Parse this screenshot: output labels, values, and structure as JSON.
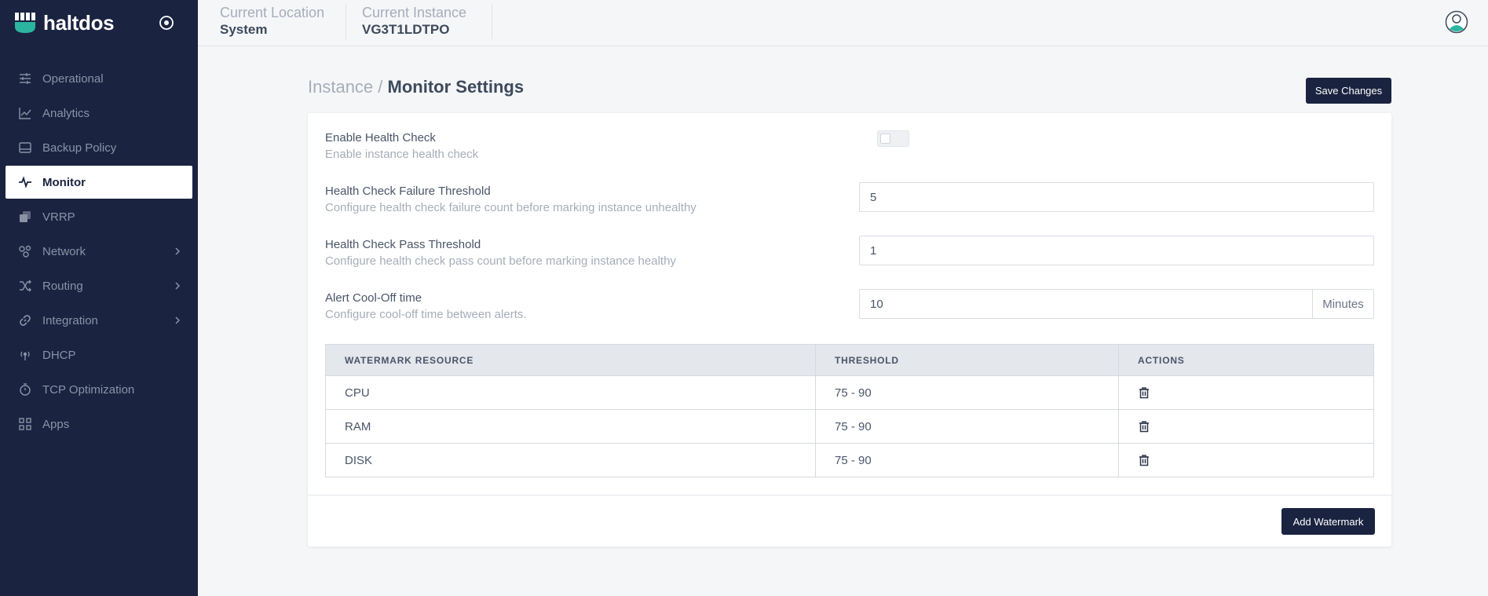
{
  "brand": {
    "name": "haltdos"
  },
  "sidebar": {
    "items": [
      {
        "label": "Operational",
        "icon": "sliders-icon",
        "active": false,
        "has_children": false
      },
      {
        "label": "Analytics",
        "icon": "chart-line-icon",
        "active": false,
        "has_children": false
      },
      {
        "label": "Backup Policy",
        "icon": "hard-drive-icon",
        "active": false,
        "has_children": false
      },
      {
        "label": "Monitor",
        "icon": "pulse-icon",
        "active": true,
        "has_children": false
      },
      {
        "label": "VRRP",
        "icon": "layers-icon",
        "active": false,
        "has_children": false
      },
      {
        "label": "Network",
        "icon": "network-icon",
        "active": false,
        "has_children": true
      },
      {
        "label": "Routing",
        "icon": "shuffle-icon",
        "active": false,
        "has_children": true
      },
      {
        "label": "Integration",
        "icon": "link-icon",
        "active": false,
        "has_children": true
      },
      {
        "label": "DHCP",
        "icon": "antenna-icon",
        "active": false,
        "has_children": false
      },
      {
        "label": "TCP Optimization",
        "icon": "stopwatch-icon",
        "active": false,
        "has_children": false
      },
      {
        "label": "Apps",
        "icon": "grid-icon",
        "active": false,
        "has_children": false
      }
    ]
  },
  "topbar": {
    "location_label": "Current Location",
    "location_value": "System",
    "instance_label": "Current Instance",
    "instance_value": "VG3T1LDTPO"
  },
  "page": {
    "breadcrumb_parent": "Instance /",
    "breadcrumb_current": "Monitor Settings",
    "save_label": "Save Changes",
    "add_watermark_label": "Add Watermark"
  },
  "settings": {
    "health_check": {
      "title": "Enable Health Check",
      "desc": "Enable instance health check",
      "enabled": false
    },
    "failure_threshold": {
      "title": "Health Check Failure Threshold",
      "desc": "Configure health check failure count before marking instance unhealthy",
      "value": "5"
    },
    "pass_threshold": {
      "title": "Health Check Pass Threshold",
      "desc": "Configure health check pass count before marking instance healthy",
      "value": "1"
    },
    "cooloff": {
      "title": "Alert Cool-Off time",
      "desc": "Configure cool-off time between alerts.",
      "value": "10",
      "unit": "Minutes"
    }
  },
  "watermarks": {
    "headers": [
      "WATERMARK RESOURCE",
      "THRESHOLD",
      "ACTIONS"
    ],
    "rows": [
      {
        "resource": "CPU",
        "threshold": "75 - 90"
      },
      {
        "resource": "RAM",
        "threshold": "75 - 90"
      },
      {
        "resource": "DISK",
        "threshold": "75 - 90"
      }
    ]
  },
  "colors": {
    "sidebar": "#1a2340",
    "accent": "#2bb5a0",
    "button": "#1a2340"
  }
}
